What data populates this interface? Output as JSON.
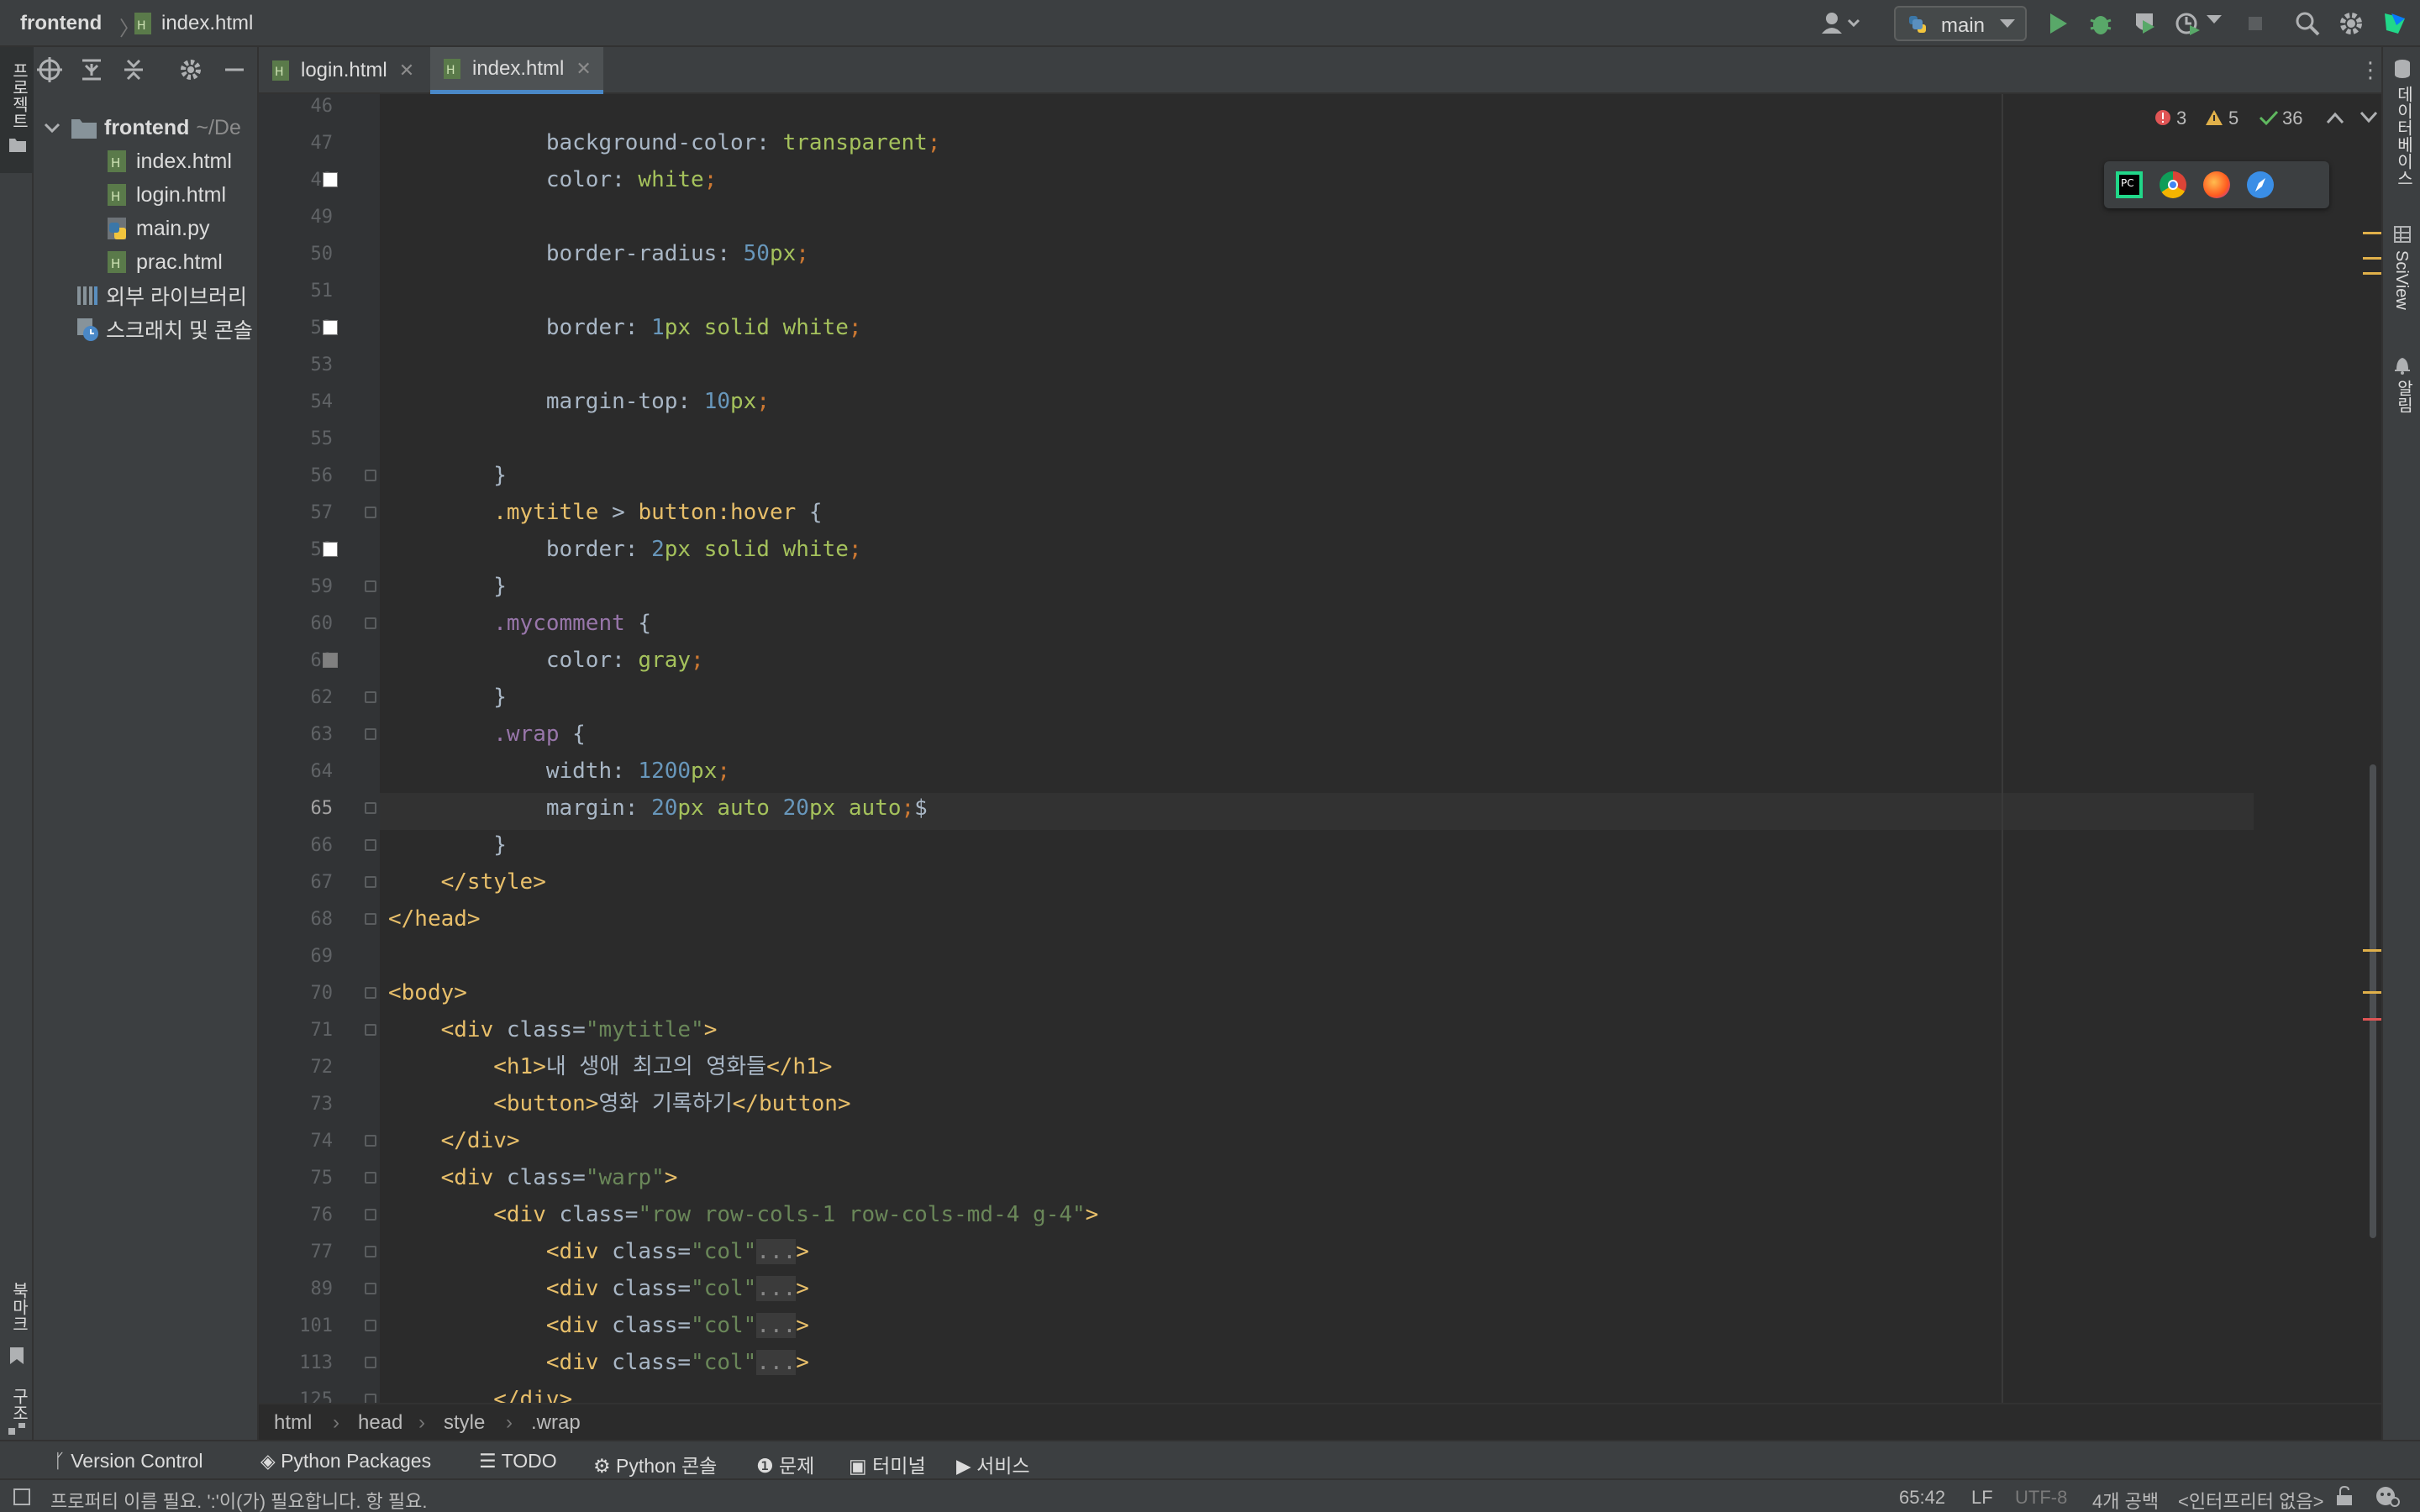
{
  "titlebar": {
    "project": "frontend",
    "file": "index.html",
    "run_config": "main"
  },
  "left_strip": {
    "project_label": "프로젝트",
    "bookmarks_label": "북마크",
    "structure_label": "구조"
  },
  "right_strip": {
    "database_label": "데이터베이스",
    "sciview_label": "SciView",
    "notifications_label": "알림"
  },
  "project_tree": {
    "root": "frontend",
    "root_path": "~/De",
    "files": [
      "index.html",
      "login.html",
      "main.py",
      "prac.html"
    ],
    "external_libs": "외부 라이브러리",
    "scratches": "스크래치 및 콘솔"
  },
  "tabs": [
    {
      "label": "login.html",
      "active": false
    },
    {
      "label": "index.html",
      "active": true
    }
  ],
  "inspections": {
    "errors": "3",
    "warnings": "5",
    "ok": "36"
  },
  "editor": {
    "line_numbers": [
      "46",
      "47",
      "48",
      "49",
      "50",
      "51",
      "52",
      "53",
      "54",
      "55",
      "56",
      "57",
      "58",
      "59",
      "60",
      "61",
      "62",
      "63",
      "64",
      "65",
      "66",
      "67",
      "68",
      "69",
      "70",
      "71",
      "72",
      "73",
      "74",
      "75",
      "76",
      "77",
      "89",
      "101",
      "113",
      "125"
    ],
    "current_line": "65",
    "lines": [
      {
        "parts": []
      },
      {
        "parts": [
          [
            "",
            "            background-color: "
          ],
          [
            "v",
            "transparent"
          ],
          [
            "c",
            ";"
          ]
        ]
      },
      {
        "parts": [
          [
            "",
            "            color: "
          ],
          [
            "v",
            "white"
          ],
          [
            "c",
            ";"
          ]
        ]
      },
      {
        "parts": []
      },
      {
        "parts": [
          [
            "",
            "            border-radius: "
          ],
          [
            "n",
            "50"
          ],
          [
            "v",
            "px"
          ],
          [
            "c",
            ";"
          ]
        ]
      },
      {
        "parts": []
      },
      {
        "parts": [
          [
            "",
            "            border: "
          ],
          [
            "n",
            "1"
          ],
          [
            "v",
            "px solid white"
          ],
          [
            "c",
            ";"
          ]
        ]
      },
      {
        "parts": []
      },
      {
        "parts": [
          [
            "",
            "            margin-top: "
          ],
          [
            "n",
            "10"
          ],
          [
            "v",
            "px"
          ],
          [
            "c",
            ";"
          ]
        ]
      },
      {
        "parts": []
      },
      {
        "parts": [
          [
            "",
            "        }"
          ]
        ]
      },
      {
        "parts": [
          [
            "",
            "        "
          ],
          [
            "sel",
            ".mytitle"
          ],
          [
            "",
            " > "
          ],
          [
            "sel",
            "button:hover"
          ],
          [
            "",
            " {"
          ]
        ]
      },
      {
        "parts": [
          [
            "",
            "            border: "
          ],
          [
            "n",
            "2"
          ],
          [
            "v",
            "px solid white"
          ],
          [
            "c",
            ";"
          ]
        ]
      },
      {
        "parts": [
          [
            "",
            "        }"
          ]
        ]
      },
      {
        "parts": [
          [
            "",
            "        "
          ],
          [
            "dim",
            ".mycomment"
          ],
          [
            "",
            " {"
          ]
        ]
      },
      {
        "parts": [
          [
            "",
            "            color: "
          ],
          [
            "v",
            "gray"
          ],
          [
            "c",
            ";"
          ]
        ]
      },
      {
        "parts": [
          [
            "",
            "        }"
          ]
        ]
      },
      {
        "parts": [
          [
            "",
            "        "
          ],
          [
            "dim",
            ".wrap"
          ],
          [
            "",
            " {"
          ]
        ]
      },
      {
        "parts": [
          [
            "",
            "            width: "
          ],
          [
            "n",
            "1200"
          ],
          [
            "v",
            "px"
          ],
          [
            "c",
            ";"
          ]
        ]
      },
      {
        "parts": [
          [
            "",
            "            margin: "
          ],
          [
            "n",
            "20"
          ],
          [
            "v",
            "px auto "
          ],
          [
            "n",
            "20"
          ],
          [
            "v",
            "px auto"
          ],
          [
            "c",
            ";"
          ],
          [
            "",
            "$"
          ]
        ]
      },
      {
        "parts": [
          [
            "",
            "        }"
          ]
        ]
      },
      {
        "parts": [
          [
            "",
            "    "
          ],
          [
            "k",
            "</style>"
          ]
        ]
      },
      {
        "parts": [
          [
            "k",
            "</head>"
          ]
        ]
      },
      {
        "parts": []
      },
      {
        "parts": [
          [
            "k",
            "<body>"
          ]
        ]
      },
      {
        "parts": [
          [
            "",
            "    "
          ],
          [
            "k",
            "<div "
          ],
          [
            "",
            "class="
          ],
          [
            "s",
            "\"mytitle\""
          ],
          [
            "k",
            ">"
          ]
        ]
      },
      {
        "parts": [
          [
            "",
            "        "
          ],
          [
            "k",
            "<h1>"
          ],
          [
            "",
            "내 생애 최고의 영화들"
          ],
          [
            "k",
            "</h1>"
          ]
        ]
      },
      {
        "parts": [
          [
            "",
            "        "
          ],
          [
            "k",
            "<button>"
          ],
          [
            "",
            "영화 기록하기"
          ],
          [
            "k",
            "</button>"
          ]
        ]
      },
      {
        "parts": [
          [
            "",
            "    "
          ],
          [
            "k",
            "</div>"
          ]
        ]
      },
      {
        "parts": [
          [
            "",
            "    "
          ],
          [
            "k",
            "<div "
          ],
          [
            "",
            "class="
          ],
          [
            "s",
            "\"warp\""
          ],
          [
            "k",
            ">"
          ]
        ]
      },
      {
        "parts": [
          [
            "",
            "        "
          ],
          [
            "k",
            "<div "
          ],
          [
            "",
            "class="
          ],
          [
            "s",
            "\"row row-cols-1 row-cols-md-4 g-4\""
          ],
          [
            "k",
            ">"
          ]
        ]
      },
      {
        "parts": [
          [
            "",
            "            "
          ],
          [
            "k",
            "<div "
          ],
          [
            "",
            "class="
          ],
          [
            "s",
            "\"col\""
          ],
          [
            "fld",
            "..."
          ],
          [
            "k",
            ">"
          ]
        ]
      },
      {
        "parts": [
          [
            "",
            "            "
          ],
          [
            "k",
            "<div "
          ],
          [
            "",
            "class="
          ],
          [
            "s",
            "\"col\""
          ],
          [
            "fld",
            "..."
          ],
          [
            "k",
            ">"
          ]
        ]
      },
      {
        "parts": [
          [
            "",
            "            "
          ],
          [
            "k",
            "<div "
          ],
          [
            "",
            "class="
          ],
          [
            "s",
            "\"col\""
          ],
          [
            "fld",
            "..."
          ],
          [
            "k",
            ">"
          ]
        ]
      },
      {
        "parts": [
          [
            "",
            "            "
          ],
          [
            "k",
            "<div "
          ],
          [
            "",
            "class="
          ],
          [
            "s",
            "\"col\""
          ],
          [
            "fld",
            "..."
          ],
          [
            "k",
            ">"
          ]
        ]
      },
      {
        "parts": [
          [
            "",
            "        "
          ],
          [
            "k",
            "</div>"
          ]
        ]
      }
    ]
  },
  "editor_breadcrumb": [
    "html",
    "head",
    "style",
    ".wrap"
  ],
  "tool_windows": [
    "Version Control",
    "Python Packages",
    "TODO",
    "Python 콘솔",
    "문제",
    "터미널",
    "서비스"
  ],
  "status": {
    "message": "프로퍼티 이름 필요. ':'이(가) 필요합니다. 항 필요.",
    "position": "65:42",
    "line_sep": "LF",
    "encoding": "UTF-8",
    "indent": "4개 공백",
    "interpreter": "<인터프리터 없음>"
  },
  "colors": {
    "accent": "#4a88c7",
    "error": "#e05555",
    "warning": "#e0b04a",
    "ok": "#5fb85f"
  }
}
